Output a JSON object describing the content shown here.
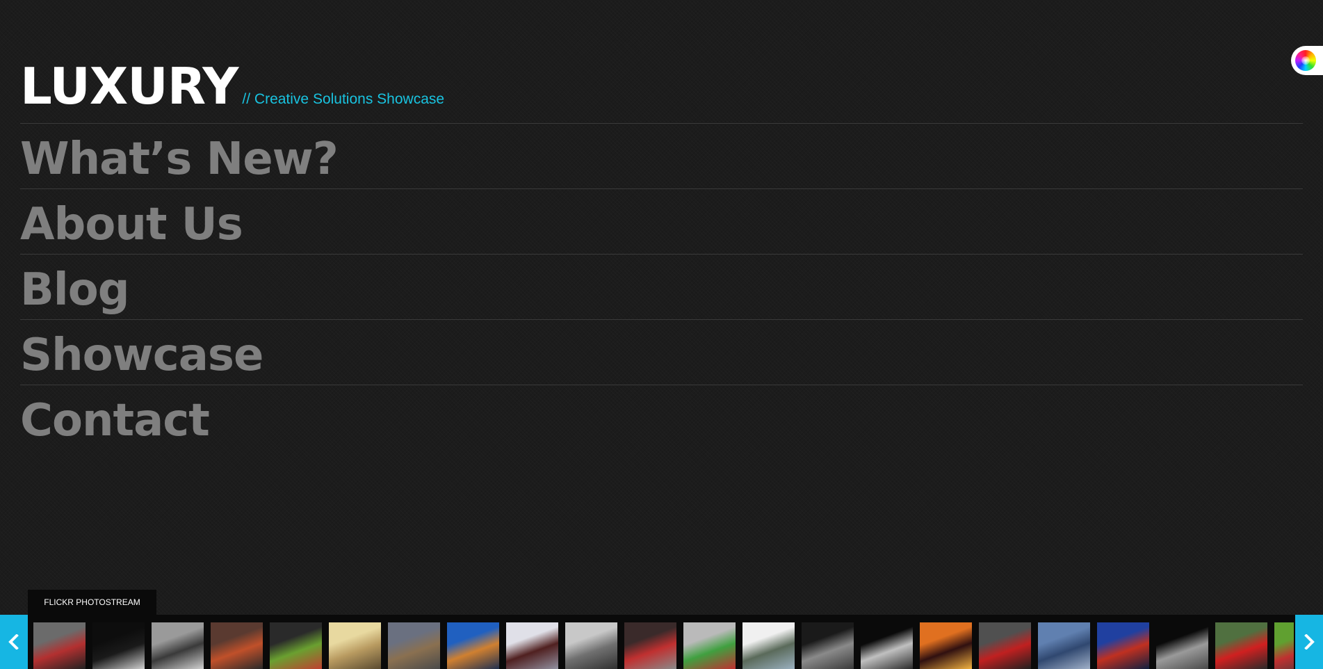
{
  "site": {
    "logo": "LUXURY",
    "tagline": "// Creative Solutions Showcase"
  },
  "nav": {
    "items": [
      {
        "label": "What’s New?"
      },
      {
        "label": "About Us"
      },
      {
        "label": "Blog"
      },
      {
        "label": "Showcase"
      },
      {
        "label": "Contact"
      }
    ]
  },
  "colors": {
    "accent": "#19c3e0",
    "arrow_bg": "#16b6e3",
    "nav_text": "#7f7f7f",
    "background": "#1c1c1c"
  },
  "flickr": {
    "tab_label": "FLICKR PHOTOSTREAM",
    "prev_icon": "chevron-left-icon",
    "next_icon": "chevron-right-icon",
    "thumbnails": [
      {
        "name": "subway-platform",
        "colors": [
          "#6b6b6b",
          "#b33030",
          "#222222"
        ]
      },
      {
        "name": "dark-figure",
        "colors": [
          "#0d0d0d",
          "#1a1a1a",
          "#cfcfcf"
        ]
      },
      {
        "name": "snowy-alley",
        "colors": [
          "#9a9a9a",
          "#3a3a3a",
          "#d0d0d0"
        ]
      },
      {
        "name": "tunnel-lights",
        "colors": [
          "#5a3a30",
          "#c0502a",
          "#2a2a2a"
        ]
      },
      {
        "name": "green-frog",
        "colors": [
          "#2a2a2a",
          "#6aa030",
          "#c04030"
        ]
      },
      {
        "name": "misty-sun",
        "colors": [
          "#e8d9a0",
          "#b89a60",
          "#5a4a30"
        ]
      },
      {
        "name": "mountain-valley",
        "colors": [
          "#6a7080",
          "#8a7050",
          "#4a4a4a"
        ]
      },
      {
        "name": "city-night",
        "colors": [
          "#2060c0",
          "#d08030",
          "#203050"
        ]
      },
      {
        "name": "car-grille",
        "colors": [
          "#e0e0e8",
          "#502020",
          "#9090a0"
        ]
      },
      {
        "name": "skyline-bw",
        "colors": [
          "#c8c8c8",
          "#707070",
          "#303030"
        ]
      },
      {
        "name": "red-car-street",
        "colors": [
          "#3a2a2a",
          "#c03030",
          "#8a8a8a"
        ]
      },
      {
        "name": "race-car",
        "colors": [
          "#bababa",
          "#40a040",
          "#c03030"
        ]
      },
      {
        "name": "cloudy-hills",
        "colors": [
          "#f0f0f0",
          "#5a6a5a",
          "#9ab0c0"
        ]
      },
      {
        "name": "arches-bw",
        "colors": [
          "#1a1a1a",
          "#8a8a8a",
          "#3a3a3a"
        ]
      },
      {
        "name": "archway-couple",
        "colors": [
          "#0a0a0a",
          "#c0c0c0",
          "#2a2a2a"
        ]
      },
      {
        "name": "orange-sunset",
        "colors": [
          "#e07020",
          "#301010",
          "#f0b040"
        ]
      },
      {
        "name": "red-motorbike",
        "colors": [
          "#505050",
          "#c02020",
          "#202020"
        ]
      },
      {
        "name": "blue-lake",
        "colors": [
          "#6080b0",
          "#304870",
          "#a0b0c8"
        ]
      },
      {
        "name": "red-tree",
        "colors": [
          "#2040a0",
          "#c03020",
          "#102040"
        ]
      },
      {
        "name": "pillars-bw",
        "colors": [
          "#0a0a0a",
          "#9a9a9a",
          "#4a4a4a"
        ]
      },
      {
        "name": "ducati-track",
        "colors": [
          "#507040",
          "#d02020",
          "#2a2a2a"
        ]
      },
      {
        "name": "car-partial",
        "colors": [
          "#60a030",
          "#c03030",
          "#3a3a3a"
        ]
      }
    ]
  }
}
